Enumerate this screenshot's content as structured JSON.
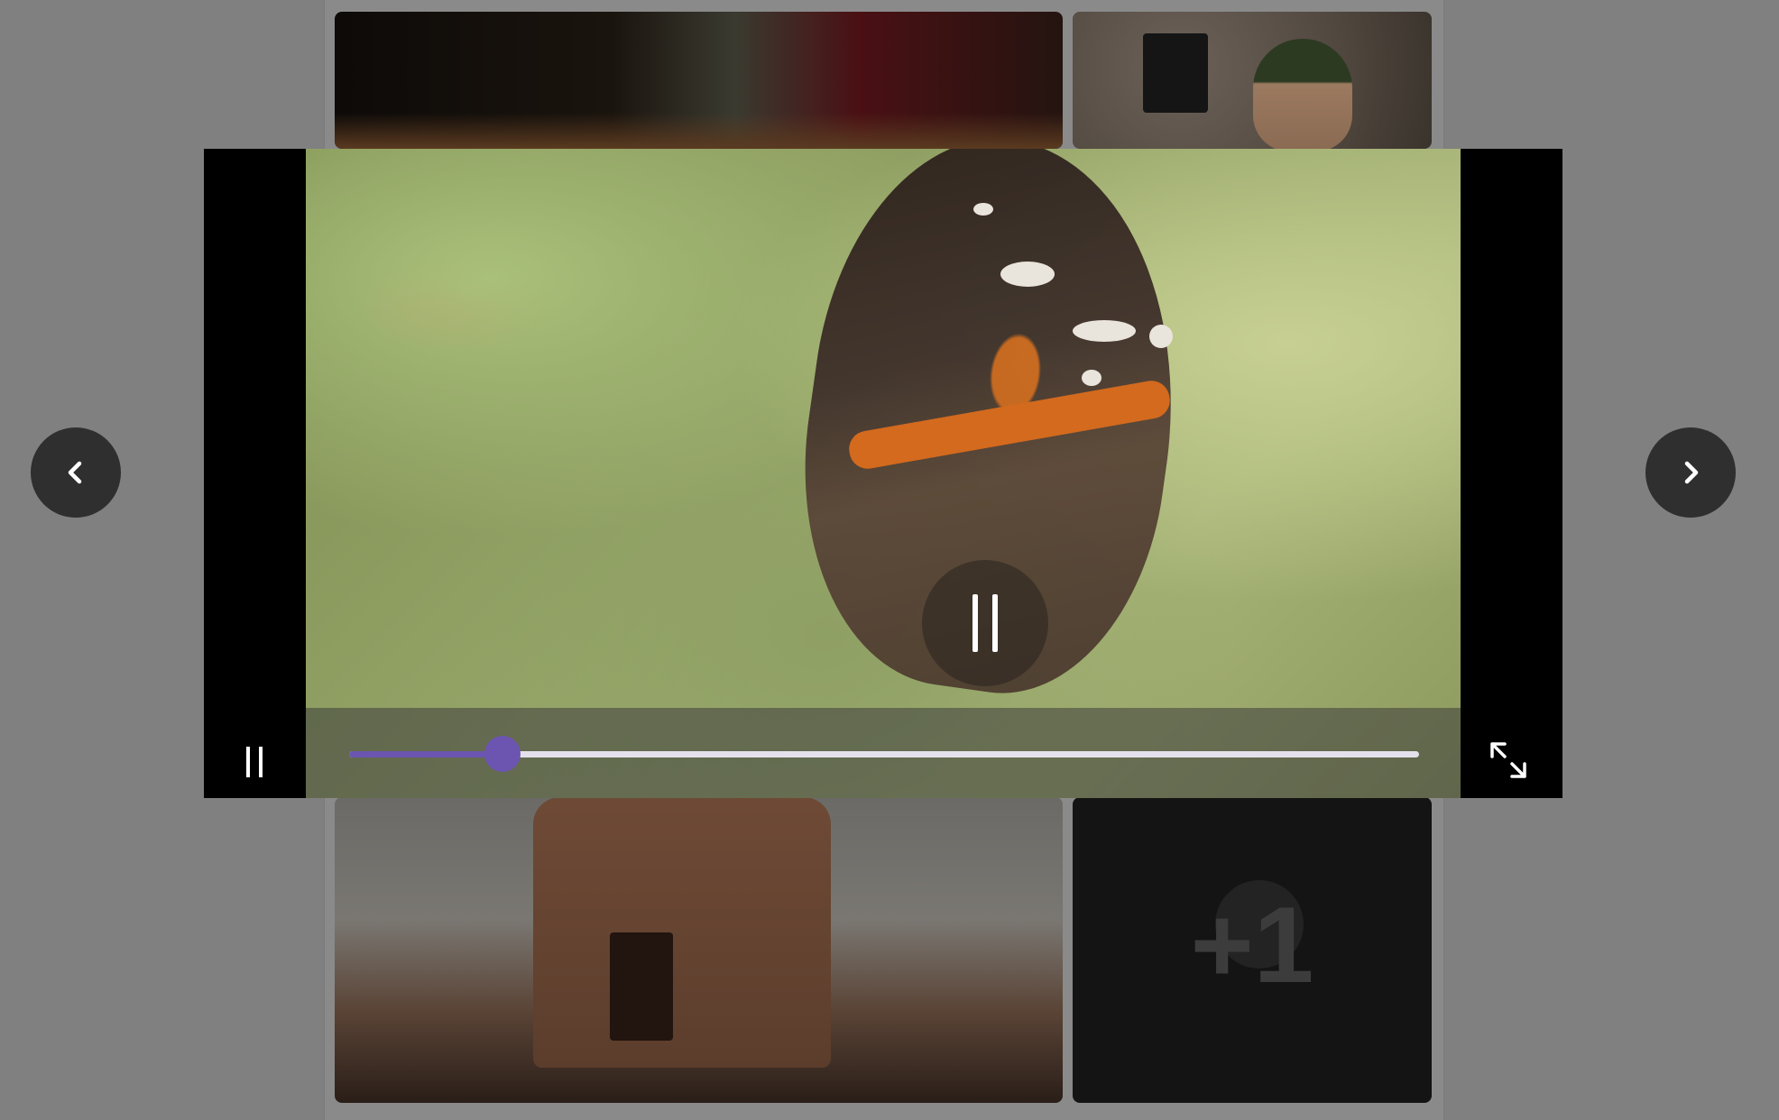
{
  "gallery": {
    "more_tile": {
      "count_label": "+1"
    }
  },
  "player": {
    "progress_fraction": 0.143,
    "accent_color": "#6b55b0",
    "state": "playing",
    "icons": {
      "center_toggle": "pause-icon",
      "side_toggle": "pause-icon",
      "fullscreen": "expand-icon",
      "previous": "chevron-left-icon",
      "next": "chevron-right-icon"
    }
  }
}
